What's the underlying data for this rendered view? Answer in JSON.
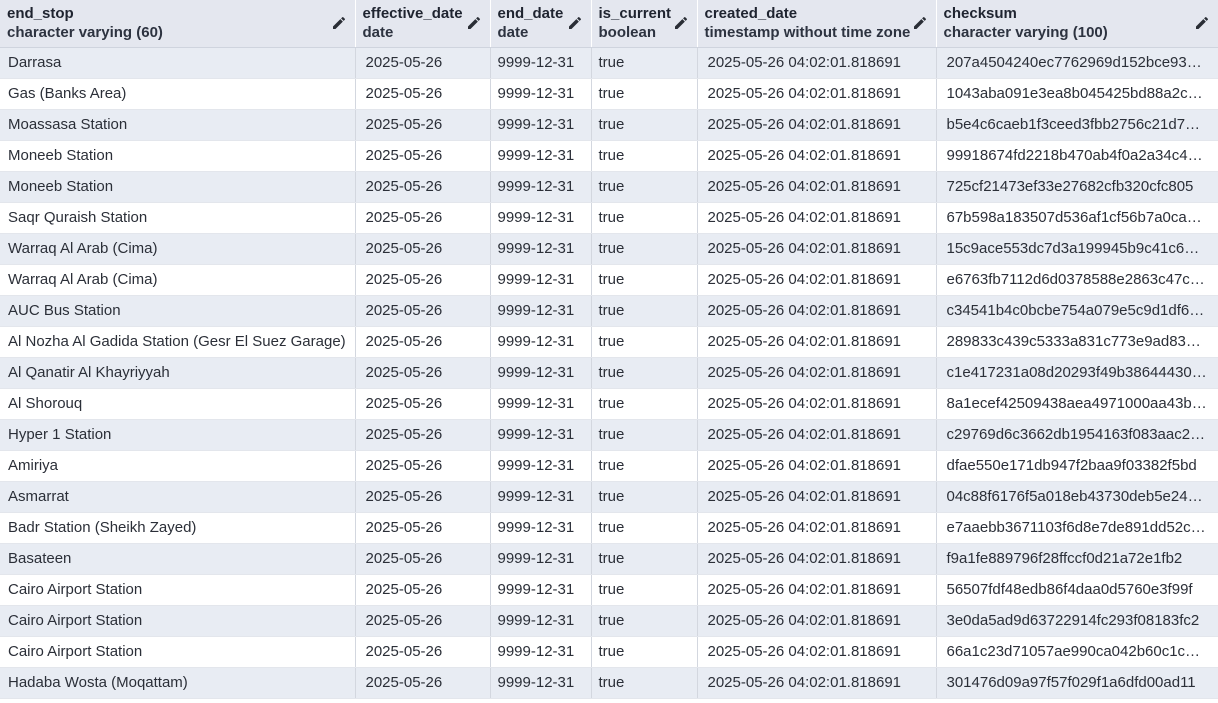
{
  "columns": [
    {
      "name": "end_stop",
      "type": "character varying (60)"
    },
    {
      "name": "effective_date",
      "type": "date"
    },
    {
      "name": "end_date",
      "type": "date"
    },
    {
      "name": "is_current",
      "type": "boolean"
    },
    {
      "name": "created_date",
      "type": "timestamp without time zone"
    },
    {
      "name": "checksum",
      "type": "character varying (100)"
    }
  ],
  "rows": [
    [
      "Darrasa",
      "2025-05-26",
      "9999-12-31",
      "true",
      "2025-05-26 04:02:01.818691",
      "207a4504240ec7762969d152bce93…"
    ],
    [
      "Gas (Banks Area)",
      "2025-05-26",
      "9999-12-31",
      "true",
      "2025-05-26 04:02:01.818691",
      "1043aba091e3ea8b045425bd88a2c…"
    ],
    [
      "Moassasa Station",
      "2025-05-26",
      "9999-12-31",
      "true",
      "2025-05-26 04:02:01.818691",
      "b5e4c6caeb1f3ceed3fbb2756c21d7…"
    ],
    [
      "Moneeb Station",
      "2025-05-26",
      "9999-12-31",
      "true",
      "2025-05-26 04:02:01.818691",
      "99918674fd2218b470ab4f0a2a34c4…"
    ],
    [
      "Moneeb Station",
      "2025-05-26",
      "9999-12-31",
      "true",
      "2025-05-26 04:02:01.818691",
      "725cf21473ef33e27682cfb320cfc805"
    ],
    [
      "Saqr Quraish Station",
      "2025-05-26",
      "9999-12-31",
      "true",
      "2025-05-26 04:02:01.818691",
      "67b598a183507d536af1cf56b7a0ca…"
    ],
    [
      "Warraq Al Arab (Cima)",
      "2025-05-26",
      "9999-12-31",
      "true",
      "2025-05-26 04:02:01.818691",
      "15c9ace553dc7d3a199945b9c41c6…"
    ],
    [
      "Warraq Al Arab (Cima)",
      "2025-05-26",
      "9999-12-31",
      "true",
      "2025-05-26 04:02:01.818691",
      "e6763fb7112d6d0378588e2863c47c…"
    ],
    [
      "AUC Bus Station",
      "2025-05-26",
      "9999-12-31",
      "true",
      "2025-05-26 04:02:01.818691",
      "c34541b4c0bcbe754a079e5c9d1df6…"
    ],
    [
      "Al Nozha Al Gadida Station (Gesr El Suez Garage)",
      "2025-05-26",
      "9999-12-31",
      "true",
      "2025-05-26 04:02:01.818691",
      "289833c439c5333a831c773e9ad83…"
    ],
    [
      "Al Qanatir Al Khayriyyah",
      "2025-05-26",
      "9999-12-31",
      "true",
      "2025-05-26 04:02:01.818691",
      "c1e417231a08d20293f49b38644430…"
    ],
    [
      "Al Shorouq",
      "2025-05-26",
      "9999-12-31",
      "true",
      "2025-05-26 04:02:01.818691",
      "8a1ecef42509438aea4971000aa43b…"
    ],
    [
      "Hyper 1 Station",
      "2025-05-26",
      "9999-12-31",
      "true",
      "2025-05-26 04:02:01.818691",
      "c29769d6c3662db1954163f083aac2…"
    ],
    [
      "Amiriya",
      "2025-05-26",
      "9999-12-31",
      "true",
      "2025-05-26 04:02:01.818691",
      "dfae550e171db947f2baa9f03382f5bd"
    ],
    [
      "Asmarrat",
      "2025-05-26",
      "9999-12-31",
      "true",
      "2025-05-26 04:02:01.818691",
      "04c88f6176f5a018eb43730deb5e24…"
    ],
    [
      "Badr Station (Sheikh Zayed)",
      "2025-05-26",
      "9999-12-31",
      "true",
      "2025-05-26 04:02:01.818691",
      "e7aaebb3671103f6d8e7de891dd52c…"
    ],
    [
      "Basateen",
      "2025-05-26",
      "9999-12-31",
      "true",
      "2025-05-26 04:02:01.818691",
      "f9a1fe889796f28ffccf0d21a72e1fb2"
    ],
    [
      "Cairo Airport Station",
      "2025-05-26",
      "9999-12-31",
      "true",
      "2025-05-26 04:02:01.818691",
      "56507fdf48edb86f4daa0d5760e3f99f"
    ],
    [
      "Cairo Airport Station",
      "2025-05-26",
      "9999-12-31",
      "true",
      "2025-05-26 04:02:01.818691",
      "3e0da5ad9d63722914fc293f08183fc2"
    ],
    [
      "Cairo Airport Station",
      "2025-05-26",
      "9999-12-31",
      "true",
      "2025-05-26 04:02:01.818691",
      "66a1c23d71057ae990ca042b60c1c…"
    ],
    [
      "Hadaba Wosta (Moqattam)",
      "2025-05-26",
      "9999-12-31",
      "true",
      "2025-05-26 04:02:01.818691",
      "301476d09a97f57f029f1a6dfd00ad11"
    ]
  ],
  "icons": {
    "column_edit": "pencil-icon"
  },
  "colors": {
    "header_bg": "#e4e7ef",
    "stripe_bg": "#e8ecf3",
    "row_bg": "#ffffff"
  }
}
